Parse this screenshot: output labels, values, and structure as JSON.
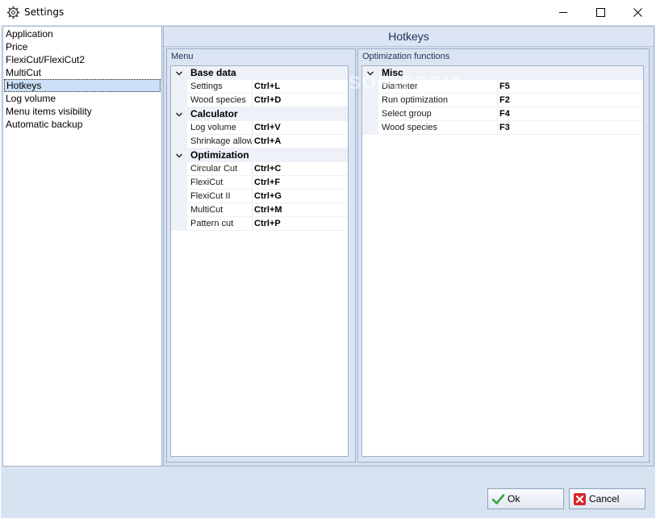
{
  "window": {
    "title": "Settings"
  },
  "nav": {
    "items": [
      {
        "label": "Application",
        "selected": false
      },
      {
        "label": "Price",
        "selected": false
      },
      {
        "label": "FlexiCut/FlexiCut2",
        "selected": false
      },
      {
        "label": "MultiCut",
        "selected": false
      },
      {
        "label": "Hotkeys",
        "selected": true
      },
      {
        "label": "Log volume",
        "selected": false
      },
      {
        "label": "Menu items visibility",
        "selected": false
      },
      {
        "label": "Automatic backup",
        "selected": false
      }
    ]
  },
  "panel": {
    "title": "Hotkeys",
    "watermark": "SOFTPEDIA"
  },
  "menu_group": {
    "title": "Menu",
    "categories": [
      {
        "name": "Base data",
        "items": [
          {
            "name": "Settings",
            "key": "Ctrl+L"
          },
          {
            "name": "Wood species",
            "key": "Ctrl+D"
          }
        ]
      },
      {
        "name": "Calculator",
        "items": [
          {
            "name": "Log volume",
            "key": "Ctrl+V"
          },
          {
            "name": "Shrinkage allow",
            "key": "Ctrl+A"
          }
        ]
      },
      {
        "name": "Optimization",
        "items": [
          {
            "name": "Circular Cut",
            "key": "Ctrl+C"
          },
          {
            "name": "FlexiCut",
            "key": "Ctrl+F"
          },
          {
            "name": "FlexiCut II",
            "key": "Ctrl+G"
          },
          {
            "name": "MultiCut",
            "key": "Ctrl+M"
          },
          {
            "name": "Pattern cut",
            "key": "Ctrl+P"
          }
        ]
      }
    ]
  },
  "opt_group": {
    "title": "Optimization functions",
    "categories": [
      {
        "name": "Misc",
        "items": [
          {
            "name": "Diameter",
            "key": "F5"
          },
          {
            "name": "Run optimization",
            "key": "F2"
          },
          {
            "name": "Select group",
            "key": "F4"
          },
          {
            "name": "Wood species",
            "key": "F3"
          }
        ]
      }
    ]
  },
  "buttons": {
    "ok_label": "Ok",
    "cancel_label": "Cancel"
  },
  "colors": {
    "client_bg": "#d8e3f2",
    "selection": "#cce0f7",
    "ok_check": "#3aa53a",
    "cancel_red": "#d9262c"
  }
}
